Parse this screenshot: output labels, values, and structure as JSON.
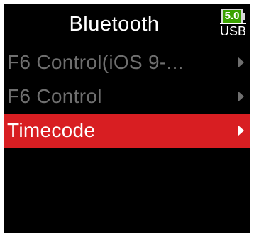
{
  "header": {
    "title": "Bluetooth"
  },
  "battery": {
    "level": "5.0",
    "source": "USB",
    "color": "#3aa100"
  },
  "menu": {
    "items": [
      {
        "label": "F6 Control(iOS 9-... ",
        "state": "disabled"
      },
      {
        "label": "F6 Control",
        "state": "disabled"
      },
      {
        "label": "Timecode",
        "state": "selected"
      }
    ]
  },
  "colors": {
    "background": "#000000",
    "selected": "#d81e22",
    "disabled_text": "#6f6f6f"
  }
}
